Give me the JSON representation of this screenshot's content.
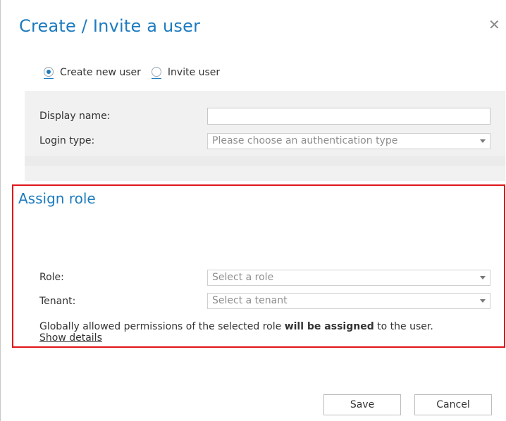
{
  "dialog": {
    "title": "Create / Invite a user",
    "close_icon": "close-icon"
  },
  "mode": {
    "options": [
      {
        "label": "Create new user",
        "checked": true
      },
      {
        "label": "Invite user",
        "checked": false
      }
    ]
  },
  "user_form": {
    "display_name_label": "Display name:",
    "display_name_value": "",
    "login_type_label": "Login type:",
    "login_type_placeholder": "Please choose an authentication type"
  },
  "assign_role": {
    "title": "Assign role",
    "role_label": "Role:",
    "role_placeholder": "Select a role",
    "tenant_label": "Tenant:",
    "tenant_placeholder": "Select a tenant",
    "info_prefix": "Globally allowed permissions of the selected role ",
    "info_bold": "will be assigned",
    "info_suffix": " to the user.",
    "details_link": "Show details"
  },
  "footer": {
    "save_label": "Save",
    "cancel_label": "Cancel"
  },
  "colors": {
    "accent": "#1d7bbf",
    "highlight_border": "#e0151a",
    "panel_bg": "#f1f1f1"
  }
}
